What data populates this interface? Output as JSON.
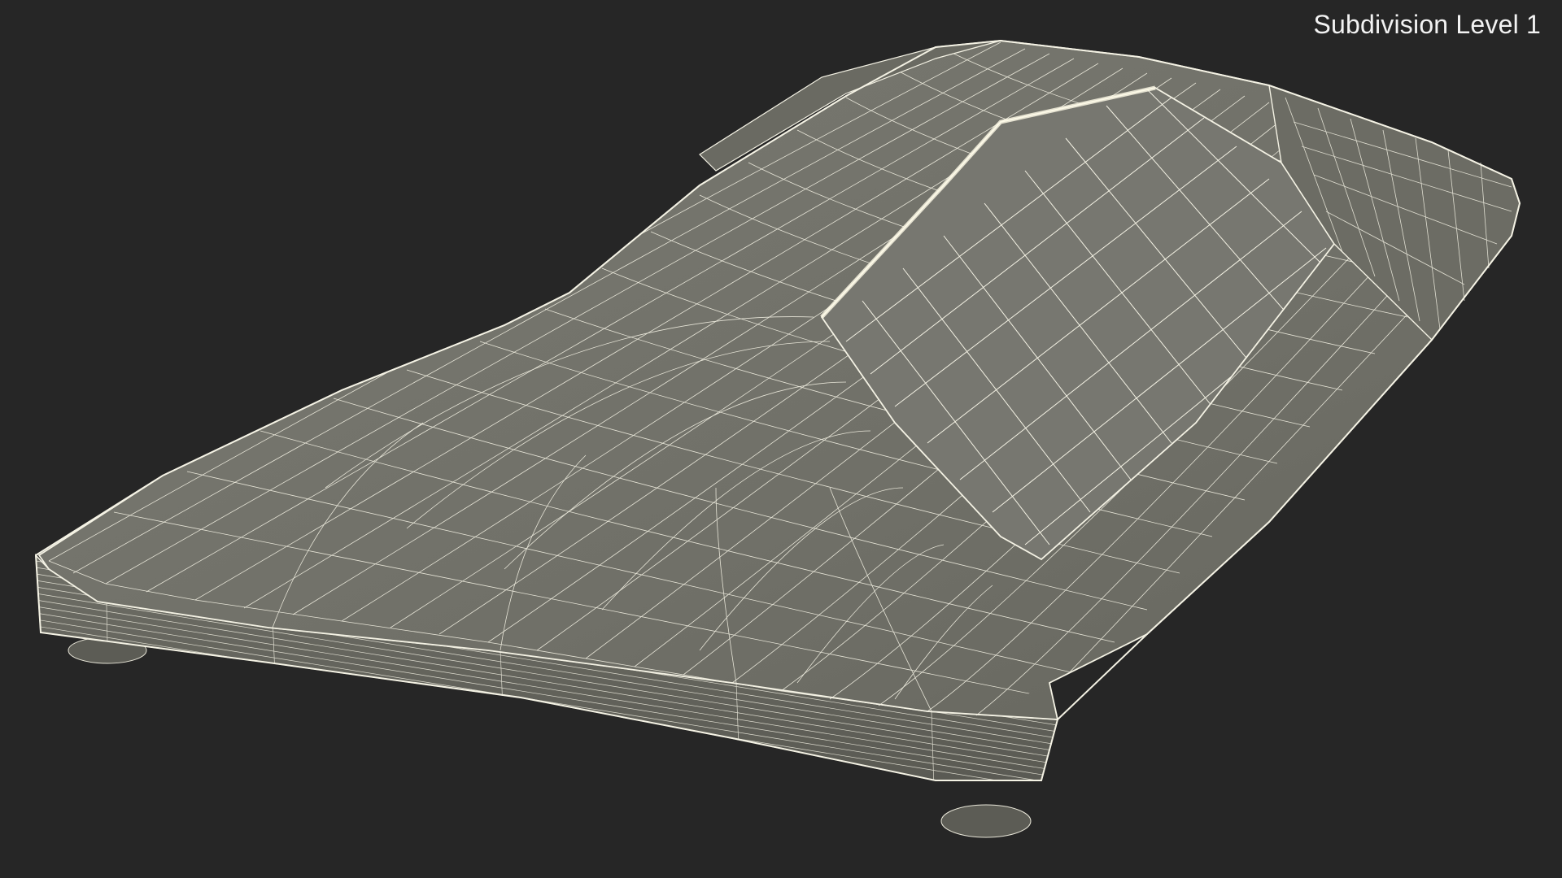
{
  "viewport": {
    "overlay_label": "Subdivision Level 1",
    "background_color": "#262626",
    "surface_color": "#707068",
    "wire_color": "#f4f2e4"
  }
}
